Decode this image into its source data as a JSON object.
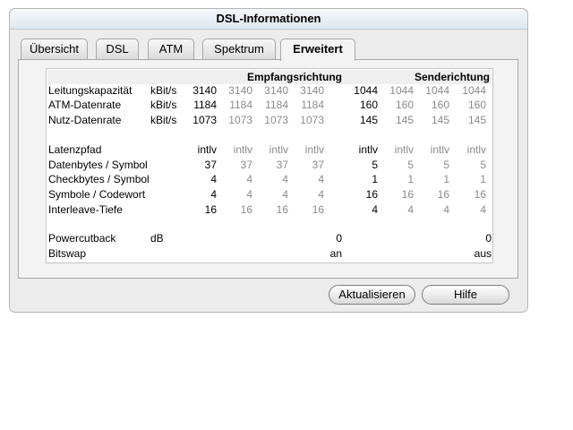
{
  "window": {
    "title": "DSL-Informationen"
  },
  "tabs": [
    {
      "label": "Übersicht"
    },
    {
      "label": "DSL"
    },
    {
      "label": "ATM"
    },
    {
      "label": "Spektrum"
    },
    {
      "label": "Erweitert",
      "active": true
    }
  ],
  "headers": {
    "rx": "Empfangsrichtung",
    "tx": "Senderichtung"
  },
  "rows": [
    {
      "label": "Leitungskapazität",
      "unit": "kBit/s",
      "rx": [
        "3140",
        "3140",
        "3140",
        "3140"
      ],
      "tx": [
        "1044",
        "1044",
        "1044",
        "1044"
      ]
    },
    {
      "label": "ATM-Datenrate",
      "unit": "kBit/s",
      "rx": [
        "1184",
        "1184",
        "1184",
        "1184"
      ],
      "tx": [
        "160",
        "160",
        "160",
        "160"
      ]
    },
    {
      "label": "Nutz-Datenrate",
      "unit": "kBit/s",
      "rx": [
        "1073",
        "1073",
        "1073",
        "1073"
      ],
      "tx": [
        "145",
        "145",
        "145",
        "145"
      ]
    },
    {
      "label": "Latenzpfad",
      "unit": "",
      "rx": [
        "intlv",
        "intlv",
        "intlv",
        "intlv"
      ],
      "tx": [
        "intlv",
        "intlv",
        "intlv",
        "intlv"
      ]
    },
    {
      "label": "Datenbytes / Symbol",
      "unit": "",
      "rx": [
        "37",
        "37",
        "37",
        "37"
      ],
      "tx": [
        "5",
        "5",
        "5",
        "5"
      ]
    },
    {
      "label": "Checkbytes / Symbol",
      "unit": "",
      "rx": [
        "4",
        "4",
        "4",
        "4"
      ],
      "tx": [
        "1",
        "1",
        "1",
        "1"
      ]
    },
    {
      "label": "Symbole / Codewort",
      "unit": "",
      "rx": [
        "4",
        "4",
        "4",
        "4"
      ],
      "tx": [
        "16",
        "16",
        "16",
        "16"
      ]
    },
    {
      "label": "Interleave-Tiefe",
      "unit": "",
      "rx": [
        "16",
        "16",
        "16",
        "16"
      ],
      "tx": [
        "4",
        "4",
        "4",
        "4"
      ]
    },
    {
      "label": "Powercutback",
      "unit": "dB",
      "rx_value": "0",
      "tx_value": "0"
    },
    {
      "label": "Bitswap",
      "unit": "",
      "rx_value": "an",
      "tx_value": "aus"
    }
  ],
  "buttons": {
    "refresh": "Aktualisieren",
    "help": "Hilfe"
  }
}
